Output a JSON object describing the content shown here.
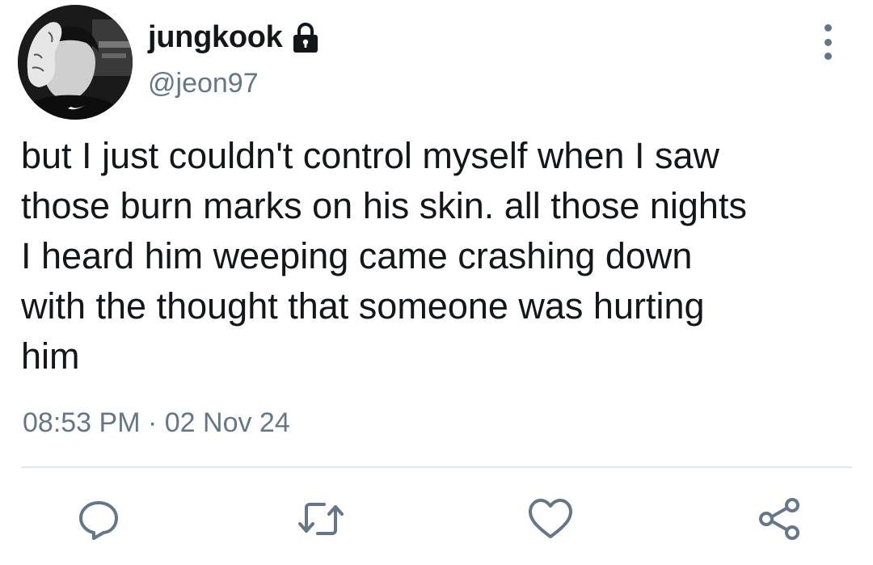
{
  "profile": {
    "display_name": "jungkook",
    "handle": "@jeon97",
    "avatar_icon": "avatar-photo",
    "protected_icon": "lock-icon"
  },
  "tweet": {
    "lines": [
      "but I just couldn't control myself when I saw",
      "those burn marks on his skin. all those nights",
      "I heard him weeping came crashing down",
      "with the thought that someone was hurting",
      "him"
    ],
    "timestamp": "08:53 PM · 02 Nov 24"
  },
  "actions": [
    {
      "name": "reply",
      "icon": "reply-icon"
    },
    {
      "name": "retweet",
      "icon": "retweet-icon"
    },
    {
      "name": "like",
      "icon": "heart-icon"
    },
    {
      "name": "share",
      "icon": "share-icon"
    }
  ],
  "colors": {
    "text_primary": "#14171a",
    "text_secondary": "#657786",
    "divider": "#e1e8ed",
    "background": "#ffffff"
  }
}
